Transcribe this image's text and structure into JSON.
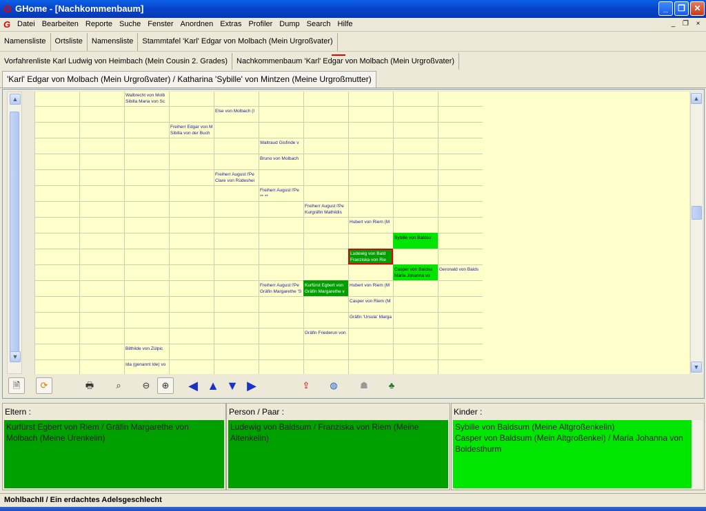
{
  "window": {
    "title": "GHome - [Nachkommenbaum]",
    "minimize": "_",
    "maximize": "❐",
    "close": "✕"
  },
  "menubar": {
    "items": [
      "Datei",
      "Bearbeiten",
      "Reporte",
      "Suche",
      "Fenster",
      "Anordnen",
      "Extras",
      "Profiler",
      "Dump",
      "Search",
      "Hilfe"
    ],
    "mdi": [
      "_",
      "❐",
      "×"
    ]
  },
  "tabs_row1": [
    "Namensliste",
    "Ortsliste",
    "Namensliste",
    "Stammtafel 'Karl' Edgar von Molbach (Mein Urgroßvater)"
  ],
  "tabs_row2": [
    "Vorfahrenliste Karl Ludwig von Heimbach (Mein Cousin 2. Grades)",
    "Nachkommenbaum 'Karl' Edgar von Molbach (Mein Urgroßvater)"
  ],
  "document_tab": "'Karl' Edgar von Molbach (Mein Urgroßvater) / Katharina 'Sybille' von Mintzen (Meine Urgroßmutter)",
  "tree_cells": [
    {
      "col": 2,
      "row": 0,
      "style": "",
      "lines": [
        "Walbrecht von Molb",
        "Sibilla Maria von Sc"
      ]
    },
    {
      "col": 4,
      "row": 1,
      "style": "",
      "lines": [
        "Else von Molbach (I",
        ""
      ]
    },
    {
      "col": 3,
      "row": 2,
      "style": "",
      "lines": [
        "Freiherr Edgar von M",
        "Sibilla von der Buch"
      ]
    },
    {
      "col": 5,
      "row": 3,
      "style": "",
      "lines": [
        "Waltraud Gisfinde v",
        ""
      ]
    },
    {
      "col": 5,
      "row": 4,
      "style": "",
      "lines": [
        "Bruno von Molbach",
        ""
      ]
    },
    {
      "col": 4,
      "row": 5,
      "style": "",
      "lines": [
        "Freiherr August l'Pe",
        "Clare von Rüdeshei"
      ]
    },
    {
      "col": 5,
      "row": 6,
      "style": "",
      "lines": [
        "Freiherr August l'Pe",
        "** **"
      ]
    },
    {
      "col": 6,
      "row": 7,
      "style": "",
      "lines": [
        "Freiherr August l'Pe",
        "Kurgräfin Mathildis"
      ]
    },
    {
      "col": 7,
      "row": 8,
      "style": "",
      "lines": [
        "Hubert von Riem (M",
        ""
      ]
    },
    {
      "col": 8,
      "row": 9,
      "style": "g",
      "lines": [
        "Sybille von Baldsu",
        ""
      ]
    },
    {
      "col": 7,
      "row": 10,
      "style": "sel",
      "lines": [
        "Ludewig von Bald",
        "Franziska von Rie"
      ]
    },
    {
      "col": 8,
      "row": 11,
      "style": "g",
      "lines": [
        "Casper von Baldsu",
        "Maria Johanna vo"
      ]
    },
    {
      "col": 9,
      "row": 11,
      "style": "",
      "lines": [
        "Geronald von Balds",
        ""
      ]
    },
    {
      "col": 5,
      "row": 12,
      "style": "",
      "lines": [
        "Freiherr August l'Pe",
        "Gräfin Margarethe 'S"
      ]
    },
    {
      "col": 6,
      "row": 12,
      "style": "dg",
      "lines": [
        "Kurfürst Egbert von",
        "Gräfin Margarethe v"
      ]
    },
    {
      "col": 7,
      "row": 12,
      "style": "",
      "lines": [
        "Hubert von Riem (M",
        ""
      ]
    },
    {
      "col": 7,
      "row": 13,
      "style": "",
      "lines": [
        "Casper von Riem (M",
        ""
      ]
    },
    {
      "col": 7,
      "row": 14,
      "style": "",
      "lines": [
        "Gräfin 'Ursula' Marga",
        ""
      ]
    },
    {
      "col": 6,
      "row": 15,
      "style": "",
      "lines": [
        "Gräfin Friederun von",
        ""
      ]
    },
    {
      "col": 2,
      "row": 16,
      "style": "",
      "lines": [
        "Bilthilde von Zülpic",
        ""
      ]
    },
    {
      "col": 2,
      "row": 17,
      "style": "",
      "lines": [
        "Ida (genannt Ide) vo",
        ""
      ]
    }
  ],
  "toolbar": {
    "tools": [
      "page-icon",
      "refresh-icon",
      "print-icon",
      "binoculars-icon",
      "zoom-out-icon",
      "zoom-fit-icon",
      "arrow-left-icon",
      "arrow-up-icon",
      "arrow-down-icon",
      "arrow-right-icon",
      "export-icon",
      "globe-icon",
      "people-icon",
      "tree-icon"
    ]
  },
  "panels": {
    "eltern": {
      "label": "Eltern :",
      "text": "Kurfürst Egbert von Riem / Gräfin Margarethe von Molbach (Meine Urenkelin)"
    },
    "person": {
      "label": "Person / Paar :",
      "text": "Ludewig von Baldsum / Franziska von Riem (Meine Altenkelin)"
    },
    "kinder": {
      "label": "Kinder :",
      "line1": "Sybille von Baldsum (Meine Altgroßenkelin)",
      "line2": "Casper von Baldsum (Mein Altgroßenkel) / Maria Johanna von Boldesthurm"
    }
  },
  "status": "MohlbachII  / Ein erdachtes Adelsgeschlecht",
  "colors": {
    "highlight": "#00e600",
    "dark": "#009e00",
    "selection_border": "#e00000",
    "grid_bg": "#ffffcc"
  }
}
